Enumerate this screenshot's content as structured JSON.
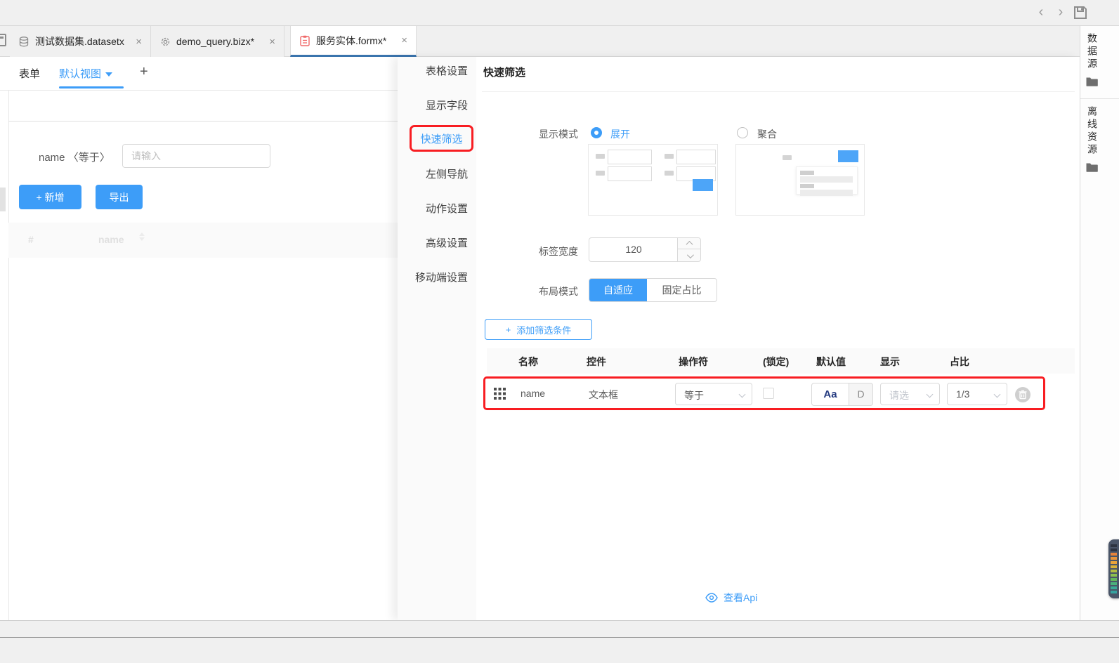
{
  "glyphs": {
    "back": "‹",
    "forward": "›",
    "close": "×",
    "plus": "+",
    "hash": "#"
  },
  "tabs": {
    "items": [
      {
        "label": "测试数据集.datasetx"
      },
      {
        "label": "demo_query.bizx*"
      },
      {
        "label": "服务实体.formx*"
      }
    ]
  },
  "designer": {
    "mode_tab": "表单",
    "view_tab": "默认视图",
    "add_view": "+",
    "filter_label": "name 〈等于〉",
    "filter_placeholder": "请输入",
    "add_button": "新增",
    "export_button": "导出",
    "ghost_table": {
      "index_col": "#",
      "name_col": "name"
    }
  },
  "drawer": {
    "menu": [
      "表格设置",
      "显示字段",
      "快速筛选",
      "左侧导航",
      "动作设置",
      "高级设置",
      "移动端设置"
    ],
    "active_menu": "快速筛选",
    "title": "快速筛选",
    "display_mode": {
      "label": "显示模式",
      "expand": "展开",
      "aggregate": "聚合",
      "selected": "展开"
    },
    "label_width": {
      "label": "标签宽度",
      "value": "120"
    },
    "layout_mode": {
      "label": "布局模式",
      "adaptive": "自适应",
      "fixed": "固定占比",
      "selected": "自适应"
    },
    "add_condition": "添加筛选条件",
    "conditions": {
      "headers": [
        "名称",
        "控件",
        "操作符",
        "(锁定)",
        "默认值",
        "显示",
        "占比"
      ],
      "row": {
        "name": "name",
        "control": "文本框",
        "operator": "等于",
        "locked": false,
        "default_style": "Aa",
        "default_type": "D",
        "display_placeholder": "请选",
        "ratio": "1/3"
      }
    },
    "api_link": "查看Api"
  },
  "sidebar": {
    "items": [
      "数据源",
      "离线资源"
    ]
  },
  "colors": {
    "accent": "#3d9df8",
    "highlight_red": "#f81d22",
    "tab_underline": "#3a74ad",
    "primary_button": "#3d9df8"
  }
}
